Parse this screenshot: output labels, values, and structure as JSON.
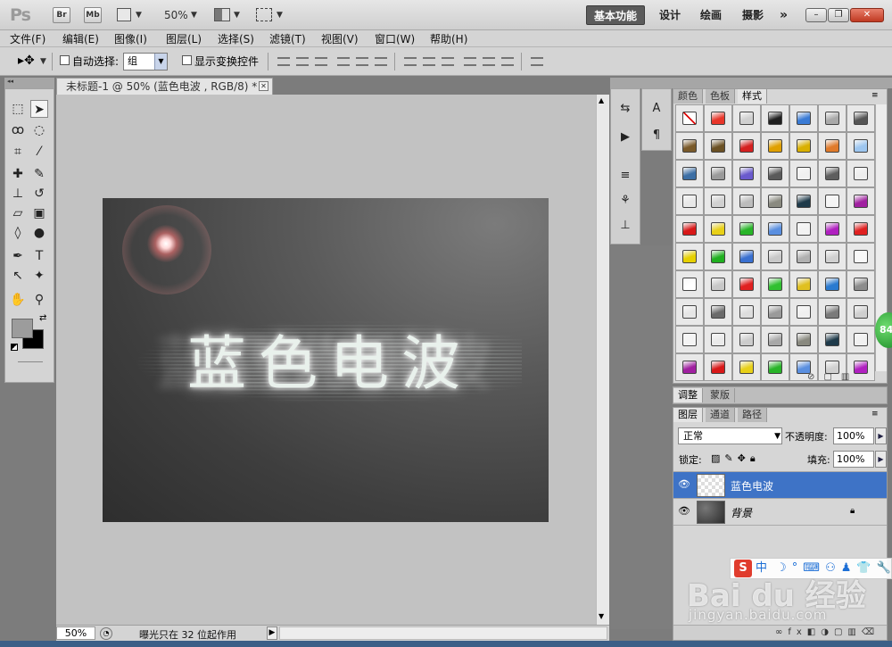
{
  "titlebar": {
    "logo": "Ps",
    "bridge_label": "Br",
    "minibridge_label": "Mb",
    "zoom": "50%",
    "workspaces": [
      "基本功能",
      "设计",
      "绘画",
      "摄影"
    ],
    "more": "»",
    "window_buttons": [
      "–",
      "❐",
      "✕"
    ]
  },
  "menu": [
    "文件(F)",
    "编辑(E)",
    "图像(I)",
    "图层(L)",
    "选择(S)",
    "滤镜(T)",
    "视图(V)",
    "窗口(W)",
    "帮助(H)"
  ],
  "options": {
    "auto_select_label": "自动选择:",
    "auto_select_value": "组",
    "show_transform_label": "显示变换控件"
  },
  "document": {
    "tab_title": "未标题-1 @ 50% (蓝色电波 , RGB/8) *",
    "canvas_text": "蓝色电波"
  },
  "status": {
    "zoom": "50%",
    "message": "曝光只在 32 位起作用"
  },
  "styles_panel": {
    "tabs": [
      "颜色",
      "色板",
      "样式"
    ],
    "active_tab": "样式"
  },
  "adjust_panel": {
    "tabs": [
      "调整",
      "蒙版"
    ]
  },
  "layers_panel": {
    "tabs": [
      "图层",
      "通道",
      "路径"
    ],
    "blend_mode": "正常",
    "opacity_label": "不透明度:",
    "opacity": "100%",
    "lock_label": "锁定:",
    "fill_label": "填充:",
    "fill": "100%",
    "layers": [
      {
        "name": "蓝色电波",
        "selected": true
      },
      {
        "name": "背景",
        "selected": false
      }
    ]
  },
  "watermark": {
    "ime_text": "中",
    "logo": "Bai du 经验",
    "url": "jingyan.baidu.com",
    "badge": "84"
  },
  "colors": {
    "foreground": "#9c9c9c",
    "background": "#000000",
    "selection": "#3e73c6",
    "accent_close": "#c03a22"
  },
  "style_swatches": [
    "#ffffff",
    "#e8362a",
    "#cfcfcf",
    "#1f1f1f",
    "#3a7bd5",
    "#a9a9a9",
    "#555555",
    "#7a5a2a",
    "#6b5124",
    "#d42020",
    "#e0a000",
    "#d9b000",
    "#e07a2a",
    "#9dc6f0",
    "#3d6fa5",
    "#9a9a9a",
    "#6a5acd",
    "#5a5a5a",
    "#f0f0f0",
    "#5e5e5e",
    "#eeeeee",
    "#e8e8e8",
    "#d0d0d0",
    "#bcbcbc",
    "#8a8a80",
    "#1e3a4a",
    "#f4f4f4",
    "#a020a0",
    "#d81818",
    "#e8d018",
    "#28b428",
    "#5a8fe0",
    "#f2f2f2",
    "#b020c0",
    "#e02020",
    "#e6d000",
    "#20b020",
    "#3a70d0",
    "#c8c8c8",
    "#b0b0b0",
    "#d0d0d0",
    "#f8f8f8",
    "#ffffff",
    "#c8c8c8",
    "#e02020",
    "#30c030",
    "#e0c020",
    "#2a7ad0",
    "#8c8c8c",
    "#e6e6e6",
    "#6a6a6a",
    "#dddddd",
    "#9a9a9a",
    "#f0f0f0",
    "#7a7a7a",
    "#cfcfcf",
    "#f4f4f4",
    "#eaeaea",
    "#cccccc",
    "#a8a8a8",
    "#8a8a80",
    "#1e3a4a",
    "#f0f0f0",
    "#a020a0",
    "#d81818",
    "#e8d018",
    "#28b428",
    "#5a8fe0",
    "#d0d0d0",
    "#b020c0"
  ]
}
